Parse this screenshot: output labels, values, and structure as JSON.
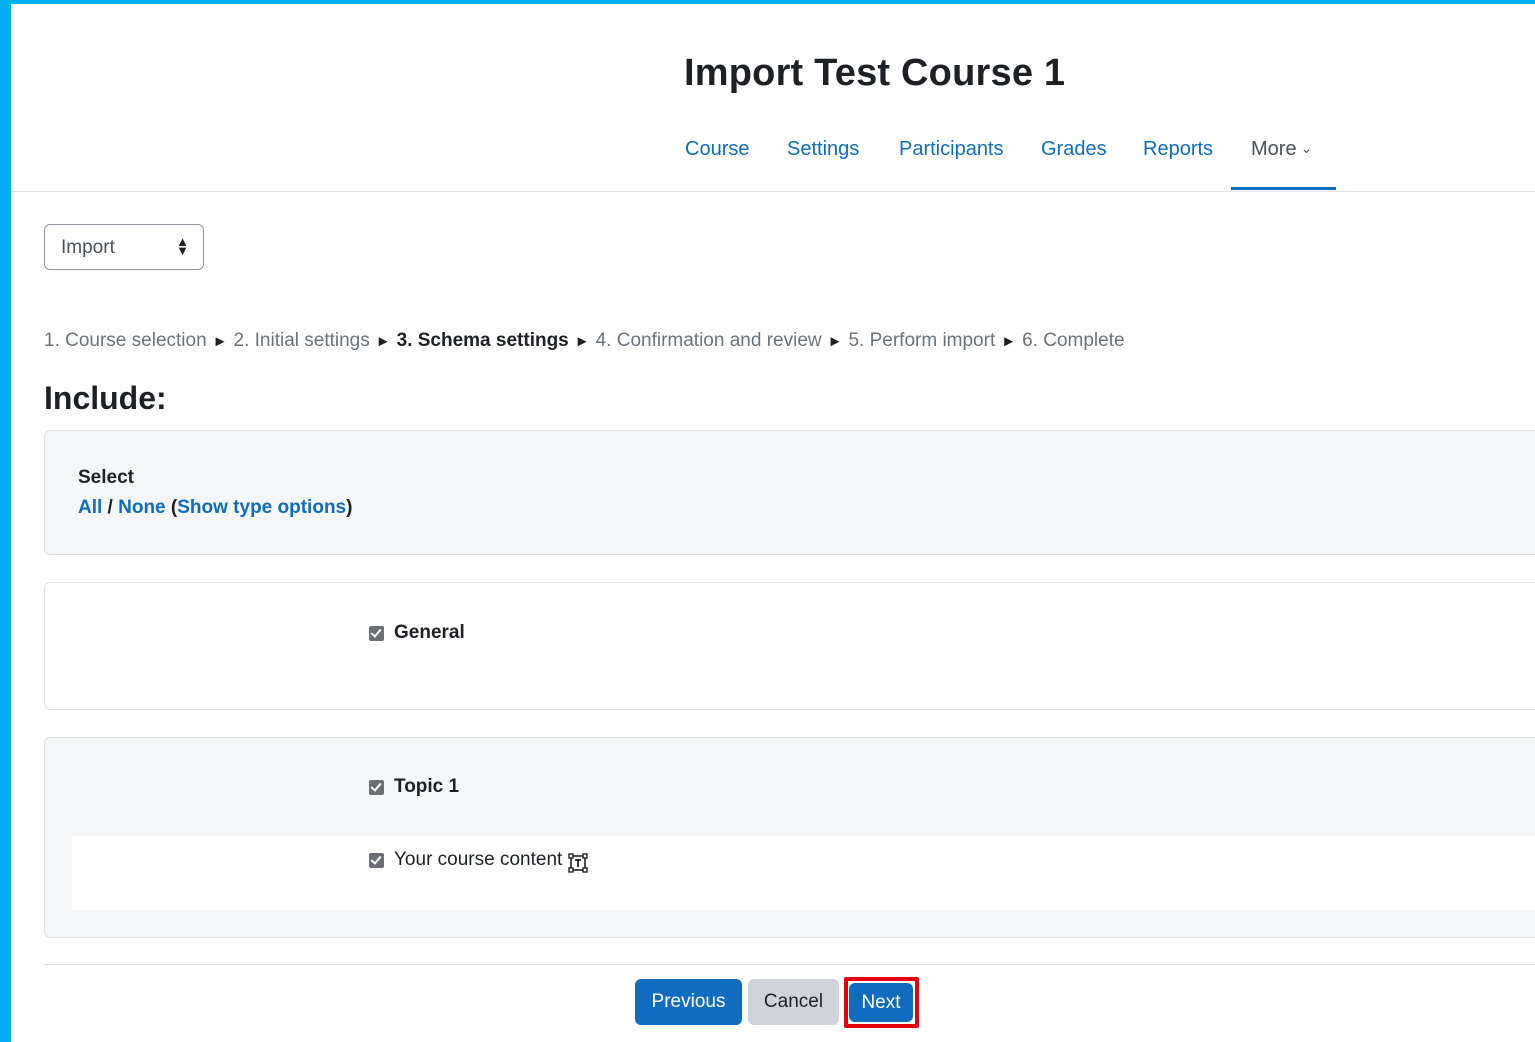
{
  "page": {
    "title": "Import Test Course 1"
  },
  "nav": {
    "items": [
      "Course",
      "Settings",
      "Participants",
      "Grades",
      "Reports"
    ],
    "more_label": "More"
  },
  "action_select": {
    "value": "Import"
  },
  "progress": {
    "steps": [
      "1. Course selection",
      "2. Initial settings",
      "3. Schema settings",
      "4. Confirmation and review",
      "5. Perform import",
      "6. Complete"
    ],
    "current_step_index": 2,
    "separator": "►"
  },
  "include": {
    "heading": "Include:",
    "select_label": "Select",
    "all_link": "All",
    "slash": " / ",
    "none_link": "None",
    "open_paren": " (",
    "show_type_options_link": "Show type options",
    "close_paren": ")"
  },
  "sections": {
    "general_label": "General",
    "topic_label": "Topic 1",
    "activity_label": "Your course content",
    "activity_icon": "page-icon"
  },
  "buttons": {
    "previous": "Previous",
    "cancel": "Cancel",
    "next": "Next"
  },
  "colors": {
    "frame": "#00aeef",
    "primary": "#0f6cbf",
    "highlight": "#e3000f"
  }
}
